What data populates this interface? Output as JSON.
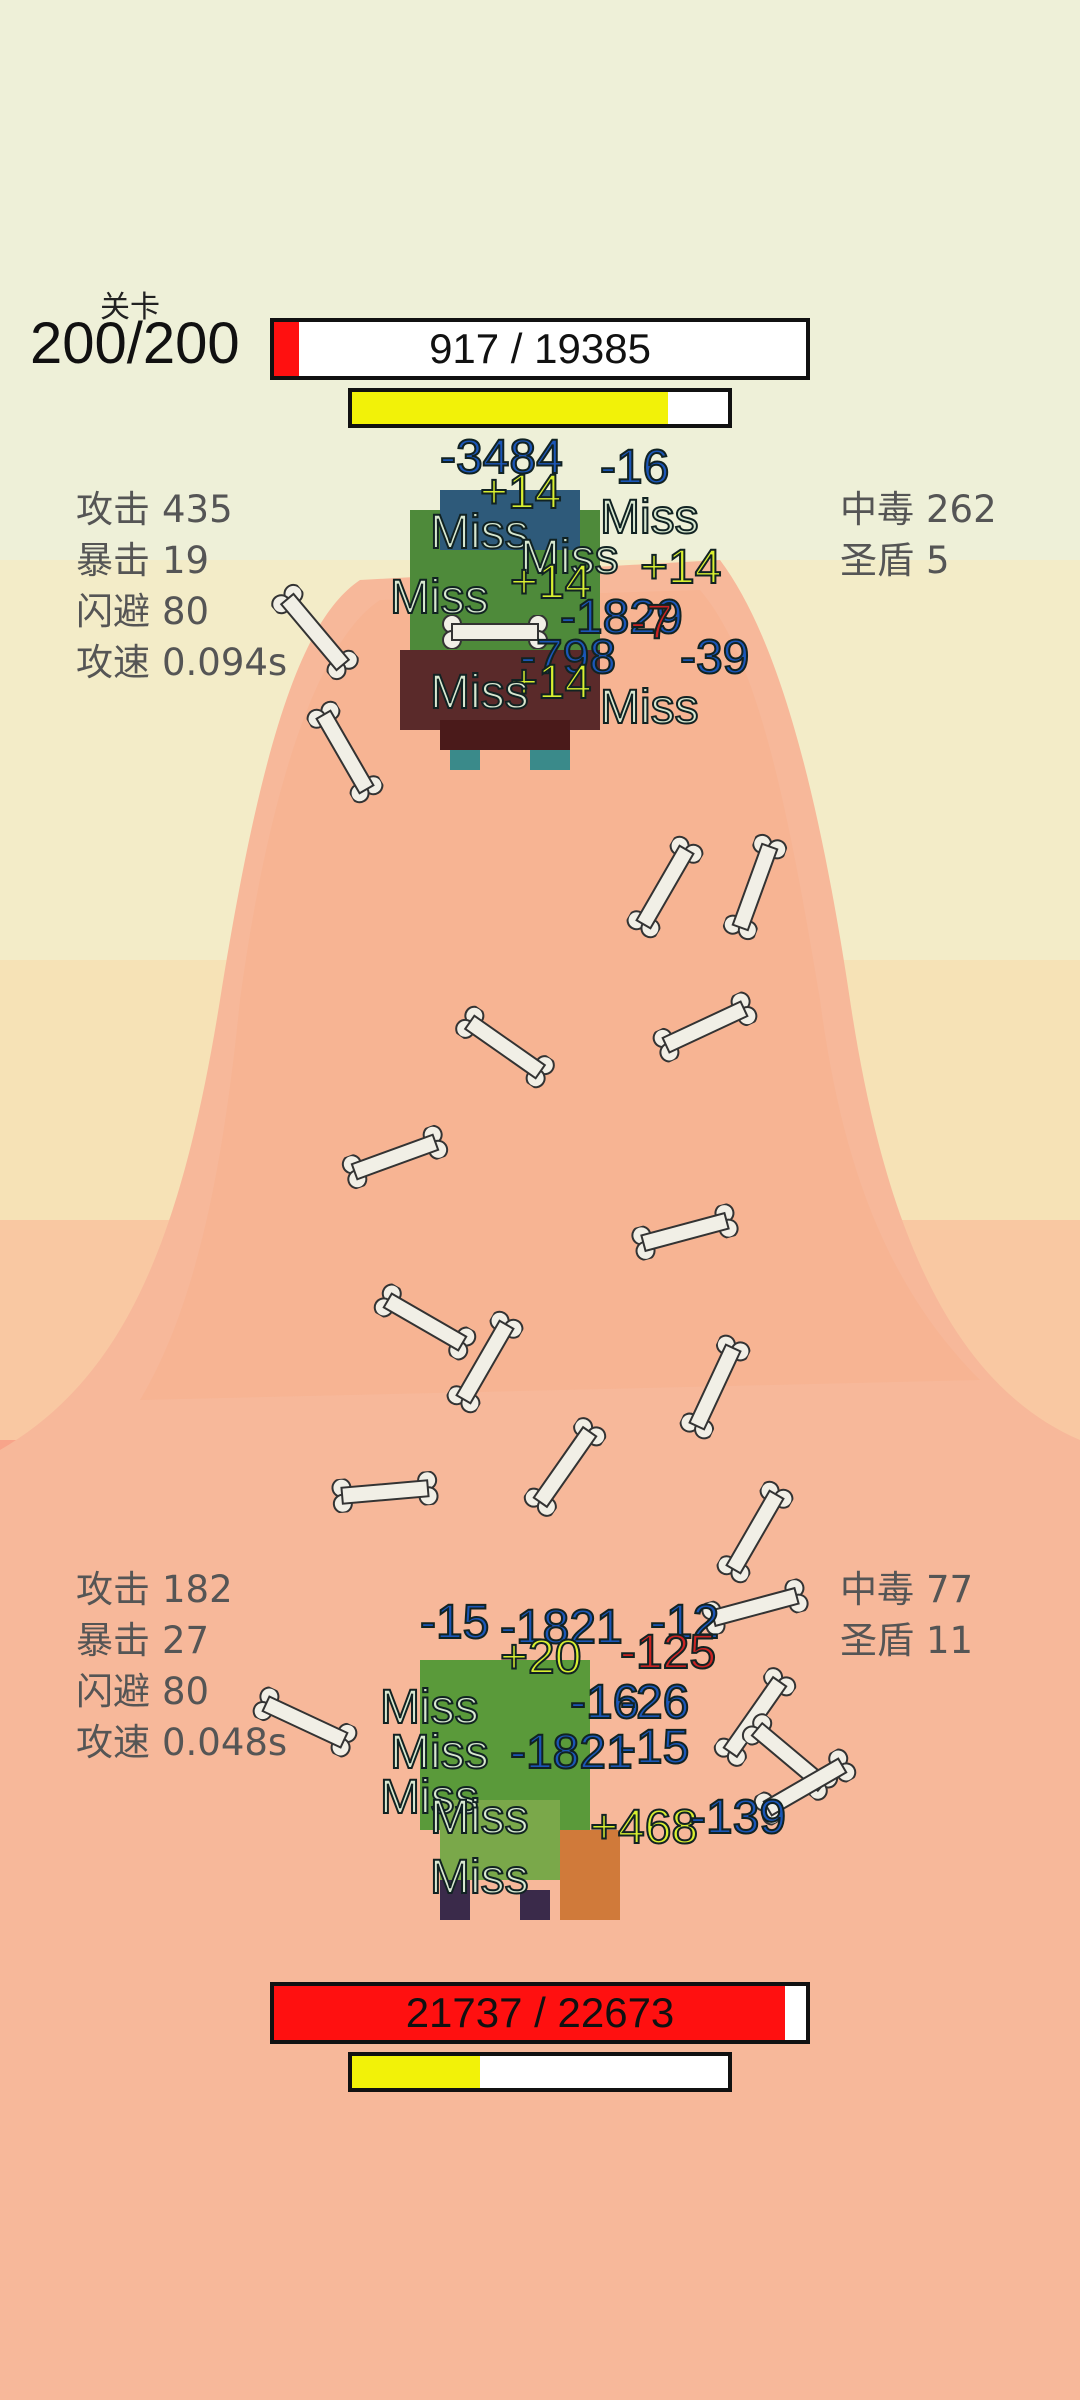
{
  "stage": {
    "label": "关卡",
    "value": "200/200"
  },
  "enemy": {
    "hp_text": "917 / 19385",
    "hp_fraction": 0.047,
    "energy_fraction": 0.84,
    "stats_left": [
      {
        "k": "攻击",
        "v": "435"
      },
      {
        "k": "暴击",
        "v": "19"
      },
      {
        "k": "闪避",
        "v": "80"
      },
      {
        "k": "攻速",
        "v": "0.094s"
      }
    ],
    "stats_right": [
      {
        "k": "中毒",
        "v": "262"
      },
      {
        "k": "圣盾",
        "v": "5"
      }
    ]
  },
  "player": {
    "hp_text": "21737 / 22673",
    "hp_fraction": 0.96,
    "energy_fraction": 0.34,
    "stats_left": [
      {
        "k": "攻击",
        "v": "182"
      },
      {
        "k": "暴击",
        "v": "27"
      },
      {
        "k": "闪避",
        "v": "80"
      },
      {
        "k": "攻速",
        "v": "0.048s"
      }
    ],
    "stats_right": [
      {
        "k": "中毒",
        "v": "77"
      },
      {
        "k": "圣盾",
        "v": "11"
      }
    ]
  },
  "floating_text": {
    "top": [
      "-3484",
      "-16",
      "+14",
      "Miss",
      "Miss",
      "Miss",
      "Miss",
      "+14",
      "+14",
      "-1829",
      "-7",
      "-798",
      "-39",
      "+14",
      "Miss",
      "Miss"
    ],
    "bottom": [
      "-15",
      "-1821",
      "-12",
      "+20",
      "-125",
      "Miss",
      "-16",
      "-26",
      "Miss",
      "Miss",
      "-1821",
      "-15",
      "+468",
      "Miss",
      "Miss",
      "-139"
    ]
  },
  "colors": {
    "hp_red": "#ff1010",
    "energy_yellow": "#f2f208",
    "bar_bg": "#ffffff"
  }
}
